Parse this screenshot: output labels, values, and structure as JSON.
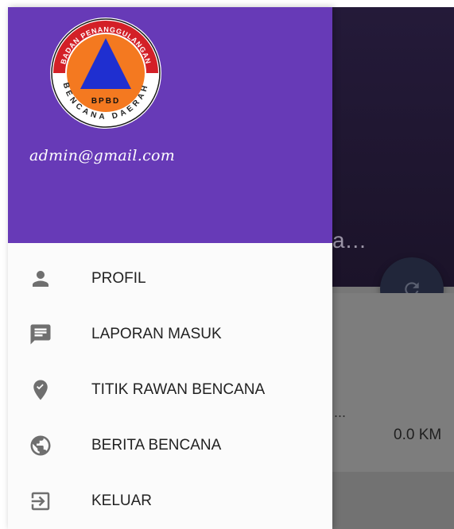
{
  "background_app": {
    "title_fragment": "a...",
    "card_dots": "...",
    "distance": "0.0 KM",
    "fab_icon": "refresh-icon"
  },
  "drawer": {
    "logo": {
      "ring_text_top": "BADAN PENANGGULANGAN",
      "ring_text_bottom": "BENCANA DAERAH",
      "center_text": "BPBD",
      "colors": {
        "ring": "#d32027",
        "disc": "#f47920",
        "triangle": "#1f2fd0"
      }
    },
    "email": "admin@gmail.com",
    "header_color": "#673ab7",
    "menu": [
      {
        "label": "PROFIL",
        "icon": "person-icon"
      },
      {
        "label": "LAPORAN MASUK",
        "icon": "message-icon"
      },
      {
        "label": "TITIK RAWAN BENCANA",
        "icon": "location-pin-icon"
      },
      {
        "label": "BERITA BENCANA",
        "icon": "globe-icon"
      },
      {
        "label": "KELUAR",
        "icon": "exit-icon"
      }
    ]
  }
}
